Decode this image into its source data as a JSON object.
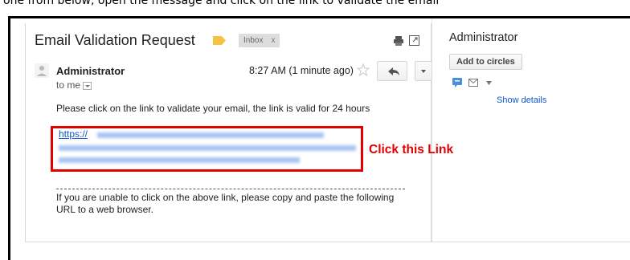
{
  "caption": "one from below, open the message and click on the link to validate the email",
  "email": {
    "subject": "Email Validation Request",
    "label_chip": "Inbox",
    "label_chip_close": "x",
    "sender": "Administrator",
    "recipient": "to me",
    "time": "8:27 AM (1 minute ago)",
    "body_line": "Please click on the link to validate your email, the link is valid for 24 hours",
    "link_prefix": "https://",
    "callout": "Click this Link",
    "footer_text": "If you are unable to click on the above link, please copy and paste the following URL to a web browser."
  },
  "sidebar": {
    "name": "Administrator",
    "add_button": "Add to circles",
    "details_link": "Show details"
  },
  "colors": {
    "highlight": "#e00000",
    "link": "#1155cc",
    "label_tag": "#f4c343"
  }
}
